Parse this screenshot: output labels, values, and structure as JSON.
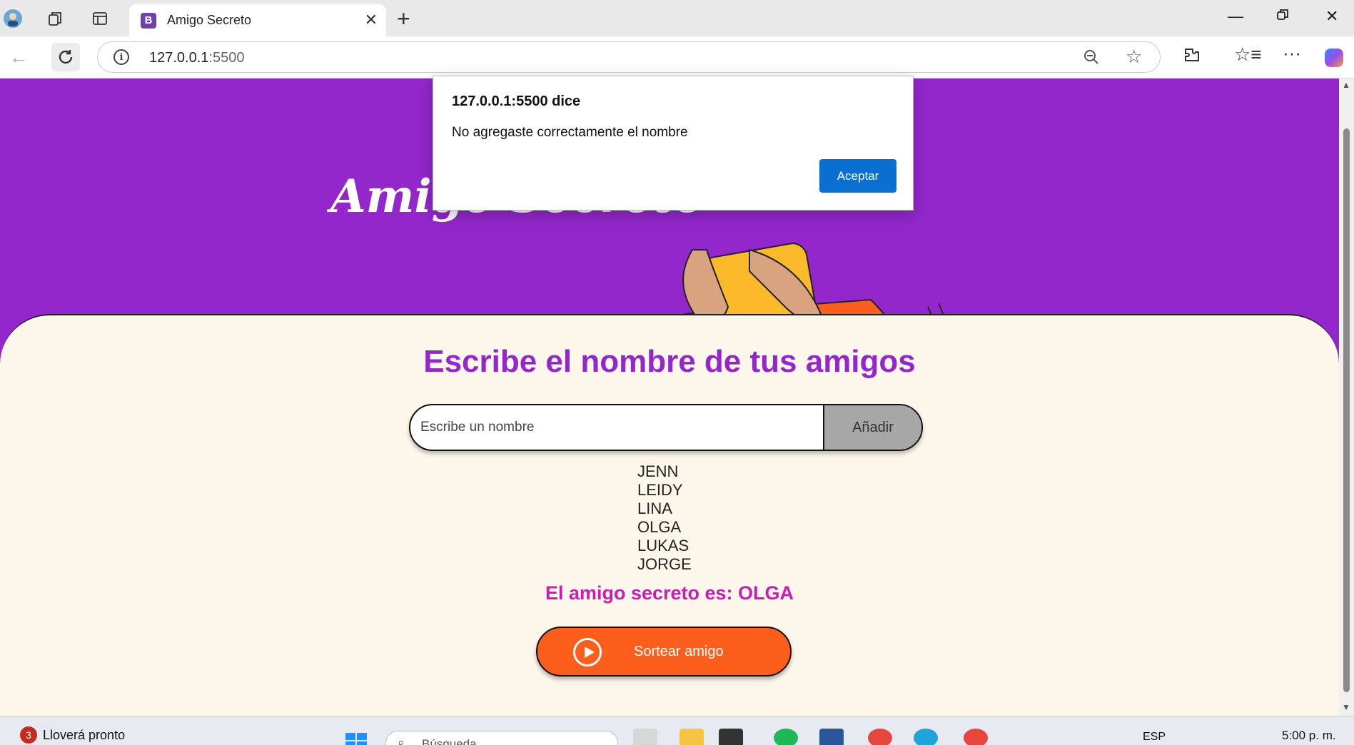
{
  "browser": {
    "tab_title": "Amigo Secreto",
    "tab_favicon_letter": "B",
    "url_host": "127.0.0.1",
    "url_port": ":5500"
  },
  "page": {
    "hero_title": "Amigo Secreto",
    "heading": "Escribe el nombre de tus amigos",
    "input_placeholder": "Escribe un nombre",
    "add_button": "Añadir",
    "friends": [
      "JENN",
      "LEIDY",
      "LINA",
      "OLGA",
      "LUKAS",
      "JORGE"
    ],
    "result": "El amigo secreto es: OLGA",
    "draw_button": "Sortear amigo"
  },
  "dialog": {
    "title": "127.0.0.1:5500 dice",
    "message": "No agregaste correctamente el nombre",
    "ok_button": "Aceptar"
  },
  "taskbar": {
    "weather_badge": "3",
    "weather_text": "Lloverá pronto",
    "search_placeholder": "Búsqueda",
    "language": "ESP",
    "time": "5:00 p. m."
  },
  "colors": {
    "hero_bg": "#9327cc",
    "content_bg": "#fdf6ea",
    "heading": "#9327cc",
    "result": "#c81fb0",
    "draw_button": "#fd5e1c",
    "dialog_button": "#0b6fd1"
  },
  "icons": [
    "profile-icon",
    "workspaces-icon",
    "tab-actions-icon",
    "close-tab-icon",
    "new-tab-icon",
    "minimize-icon",
    "restore-icon",
    "close-window-icon",
    "back-icon",
    "refresh-icon",
    "site-info-icon",
    "zoom-icon",
    "favorite-star-icon",
    "extensions-icon",
    "favorites-icon",
    "more-icon",
    "copilot-icon",
    "play-icon"
  ]
}
